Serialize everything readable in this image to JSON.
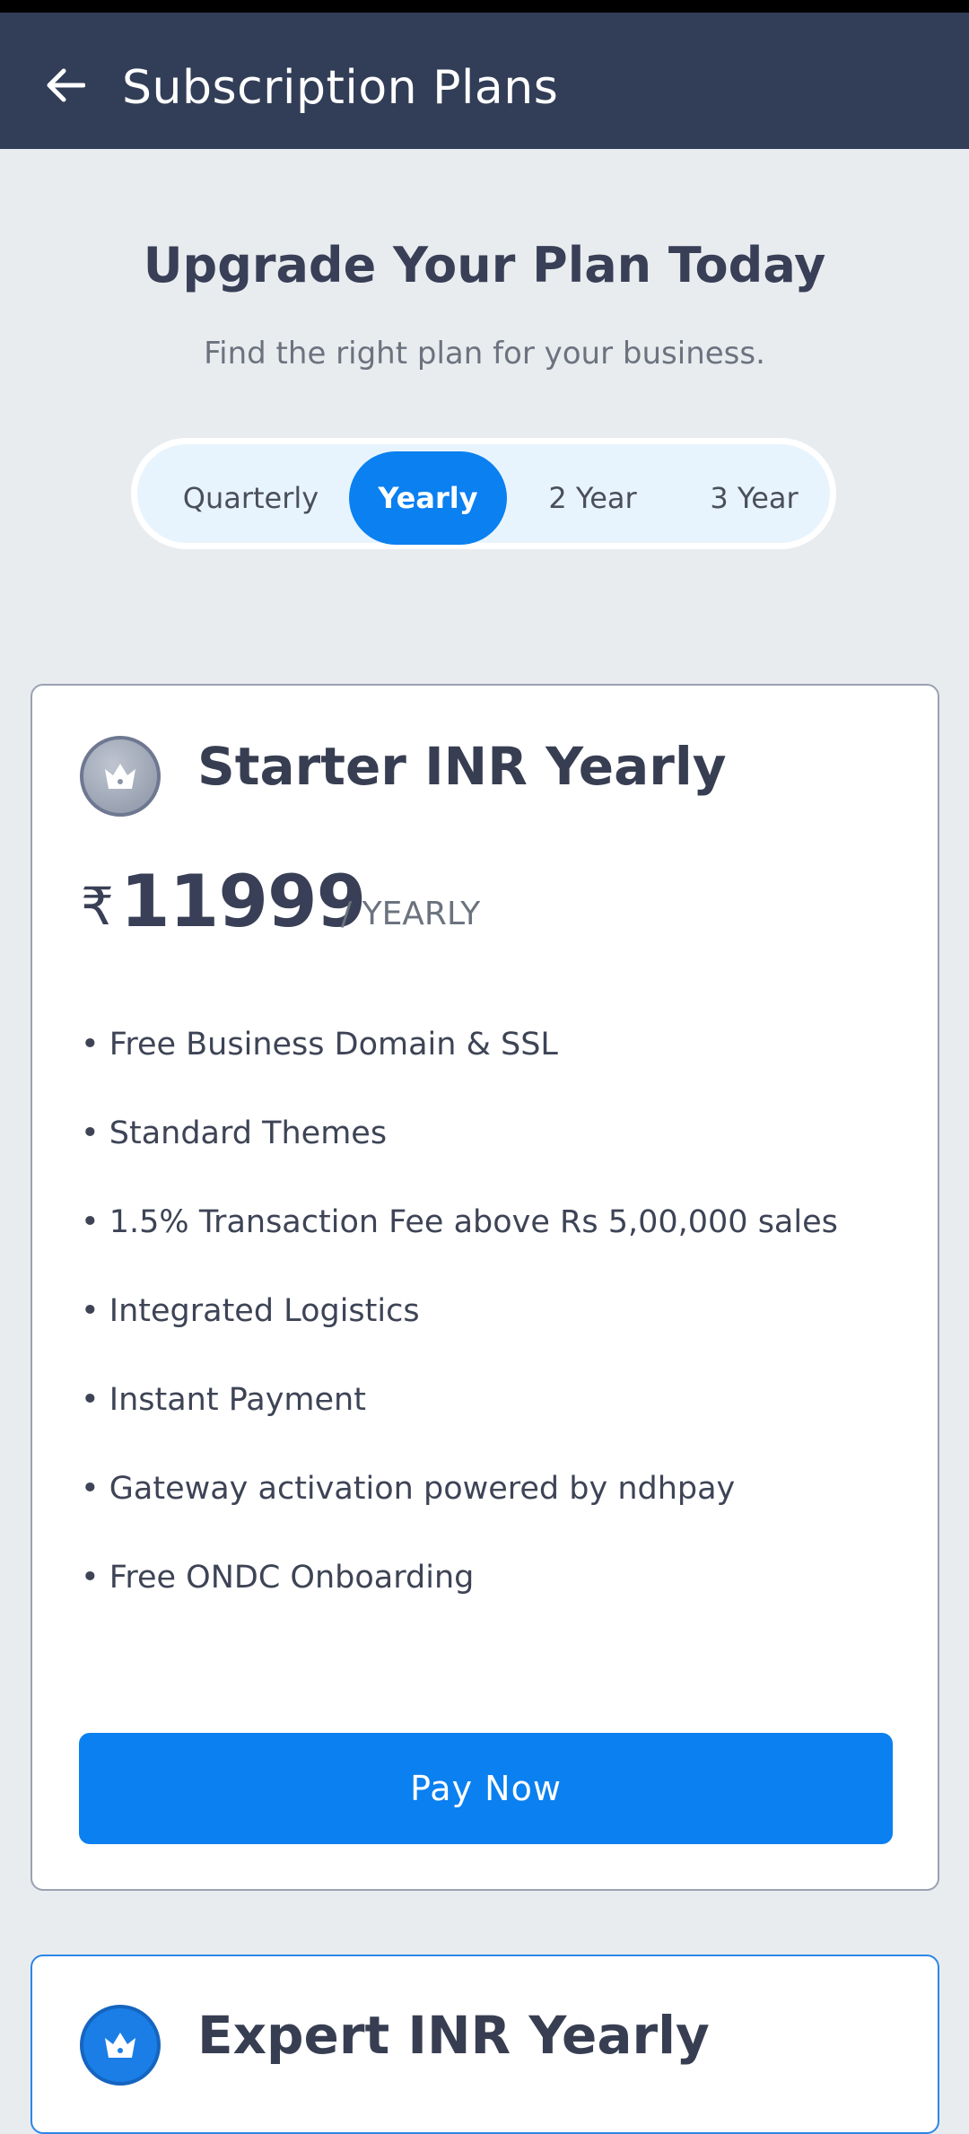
{
  "app_bar": {
    "title": "Subscription Plans",
    "back_icon": "arrow-left-icon"
  },
  "hero": {
    "heading": "Upgrade Your Plan Today",
    "subheading": "Find the right plan for your business."
  },
  "billing_toggle": {
    "options": [
      "Quarterly",
      "Yearly",
      "2 Year",
      "3 Year"
    ],
    "selected": "Yearly"
  },
  "plans": [
    {
      "name": "Starter INR Yearly",
      "icon": "crown-icon",
      "currency_symbol": "₹",
      "price": "11999",
      "period": "/ YEARLY",
      "features": [
        "• Free Business Domain & SSL",
        "• Standard Themes",
        "• 1.5% Transaction Fee above Rs 5,00,000 sales",
        "• Integrated Logistics",
        "• Instant Payment",
        "• Gateway activation powered by ndhpay",
        "• Free ONDC Onboarding"
      ],
      "button_label": "Pay Now"
    },
    {
      "name": "Expert INR Yearly",
      "icon": "crown-icon"
    }
  ],
  "colors": {
    "app_bar": "#323e57",
    "accent": "#0b80f0",
    "background": "#e9ecef",
    "heading_text": "#393f56",
    "muted_text": "#6c737f"
  }
}
